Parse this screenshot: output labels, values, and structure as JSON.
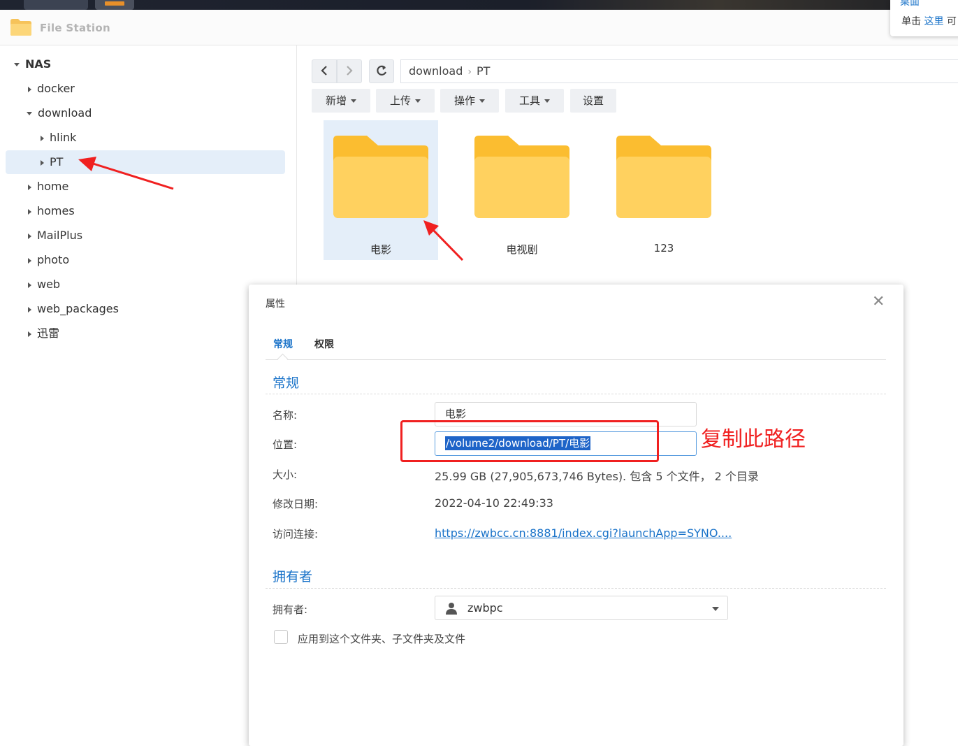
{
  "app": {
    "title": "File Station"
  },
  "notification": {
    "title": "桌面",
    "text": "单击",
    "link": "这里",
    "tail": "可"
  },
  "sidebar": {
    "root": "NAS",
    "items": [
      {
        "label": "docker"
      },
      {
        "label": "download"
      },
      {
        "label": "hlink"
      },
      {
        "label": "PT"
      },
      {
        "label": "home"
      },
      {
        "label": "homes"
      },
      {
        "label": "MailPlus"
      },
      {
        "label": "photo"
      },
      {
        "label": "web"
      },
      {
        "label": "web_packages"
      },
      {
        "label": "迅雷"
      }
    ]
  },
  "path": {
    "segments": [
      "download",
      "PT"
    ]
  },
  "toolbar": {
    "new": "新增",
    "upload": "上传",
    "action": "操作",
    "tools": "工具",
    "settings": "设置"
  },
  "files": [
    {
      "name": "电影"
    },
    {
      "name": "电视剧"
    },
    {
      "name": "123"
    }
  ],
  "colors": {
    "accent": "#1a73c9",
    "folder": "#ffd15f",
    "folder_tab": "#fbbd30",
    "annotation": "#f02020"
  },
  "dialog": {
    "title": "属性",
    "tabs": [
      "常规",
      "权限"
    ],
    "general_section": "常规",
    "fields": {
      "name_label": "名称:",
      "name_value": "电影",
      "location_label": "位置:",
      "location_value": "/volume2/download/PT/电影",
      "size_label": "大小:",
      "size_value": "25.99 GB (27,905,673,746 Bytes). 包含 5 个文件， 2 个目录",
      "modified_label": "修改日期:",
      "modified_value": "2022-04-10 22:49:33",
      "link_label": "访问连接:",
      "link_value": "https://zwbcc.cn:8881/index.cgi?launchApp=SYNO...."
    },
    "owner_section": "拥有者",
    "owner_label": "拥有者:",
    "owner_value": "zwbpc",
    "apply_label": "应用到这个文件夹、子文件夹及文件"
  },
  "annotation": {
    "text": "复制此路径"
  }
}
